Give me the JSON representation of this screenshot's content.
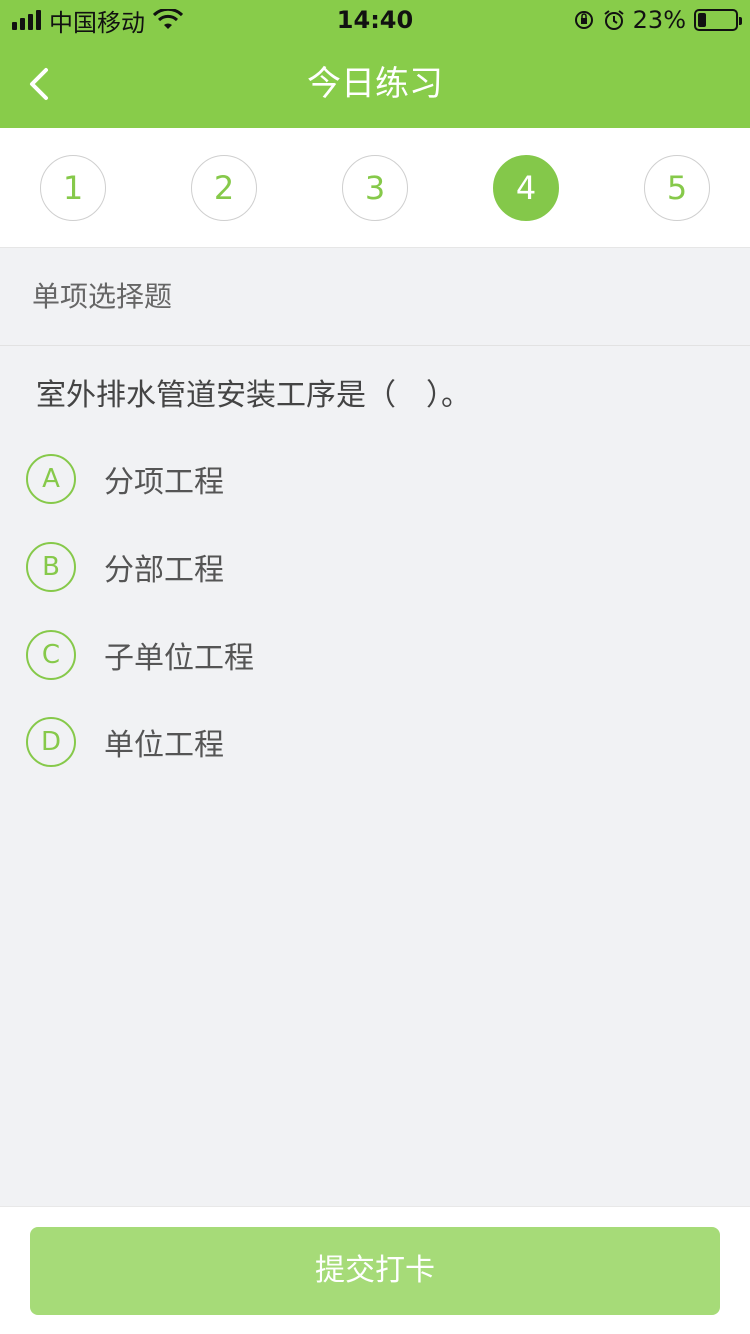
{
  "status_bar": {
    "carrier": "中国移动",
    "time": "14:40",
    "battery_percent": "23%",
    "battery_level": 0.23,
    "icons": [
      "signal-icon",
      "wifi-icon",
      "rotation-lock-icon",
      "alarm-icon",
      "battery-icon"
    ]
  },
  "nav": {
    "title": "今日练习",
    "back_icon": "chevron-left-icon"
  },
  "steps": [
    {
      "label": "1",
      "active": false
    },
    {
      "label": "2",
      "active": false
    },
    {
      "label": "3",
      "active": false
    },
    {
      "label": "4",
      "active": true
    },
    {
      "label": "5",
      "active": false
    }
  ],
  "question": {
    "type_label": "单项选择题",
    "text": "室外排水管道安装工序是（　）。",
    "options": [
      {
        "letter": "A",
        "text": "分项工程"
      },
      {
        "letter": "B",
        "text": "分部工程"
      },
      {
        "letter": "C",
        "text": "子单位工程"
      },
      {
        "letter": "D",
        "text": "单位工程"
      }
    ]
  },
  "footer": {
    "submit_label": "提交打卡"
  },
  "colors": {
    "brand_green": "#88cc4a",
    "active_step": "#84c84a",
    "submit_button": "#a6db78",
    "background": "#f1f2f4"
  }
}
